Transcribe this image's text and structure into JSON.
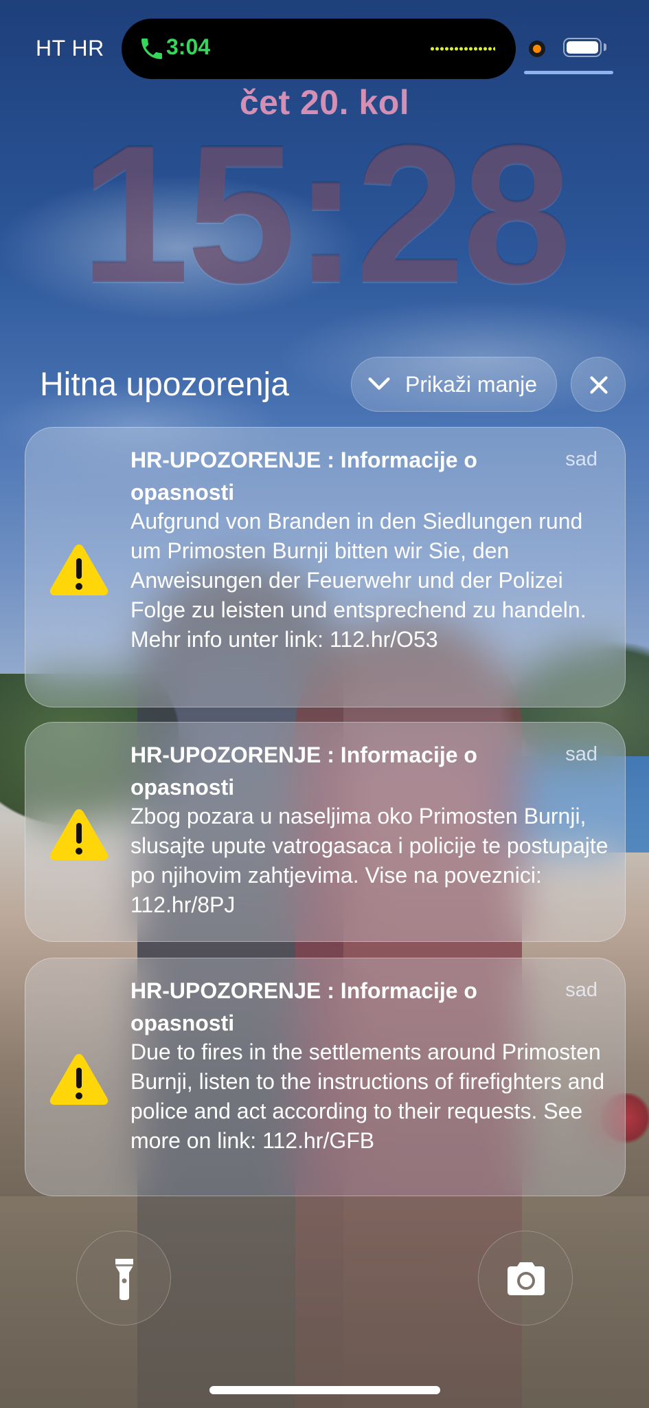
{
  "status_bar": {
    "carrier": "HT HR",
    "call_time": "3:04",
    "call_color": "#35d75a",
    "battery_icon": "battery-icon",
    "recording_indicator_color": "#ff8a00"
  },
  "lock_screen": {
    "date": "čet 20. kol",
    "time": "15:28",
    "date_color": "#d48fb5"
  },
  "notifications": {
    "section_title": "Hitna upozorenja",
    "show_less_label": "Prikaži manje",
    "show_less_icon": "chevron-down-icon",
    "close_icon": "close-icon",
    "alerts": [
      {
        "icon": "warning-icon",
        "title": "HR-UPOZORENJE : Informacije o opasnosti",
        "time": "sad",
        "body": "Aufgrund von Branden in den Siedlungen rund um Primosten Burnji bitten wir Sie, den Anweisungen der Feuerwehr und der Polizei Folge zu leisten und entsprechend zu handeln. Mehr info unter link: 112.hr/O53"
      },
      {
        "icon": "warning-icon",
        "title": "HR-UPOZORENJE : Informacije o opasnosti",
        "time": "sad",
        "body": "Zbog pozara u naseljima oko Primosten Burnji, slusajte upute vatrogasaca i policije te postupajte po njihovim zahtjevima. Vise na poveznici: 112.hr/8PJ"
      },
      {
        "icon": "warning-icon",
        "title": "HR-UPOZORENJE : Informacije o opasnosti",
        "time": "sad",
        "body": "Due to fires in the settlements around Primosten Burnji, listen to the instructions of firefighters and police and act according to their requests. See more on link: 112.hr/GFB"
      }
    ],
    "warning_color": "#ffd60a"
  },
  "quick_actions": {
    "left_icon": "flashlight-icon",
    "right_icon": "camera-icon"
  }
}
